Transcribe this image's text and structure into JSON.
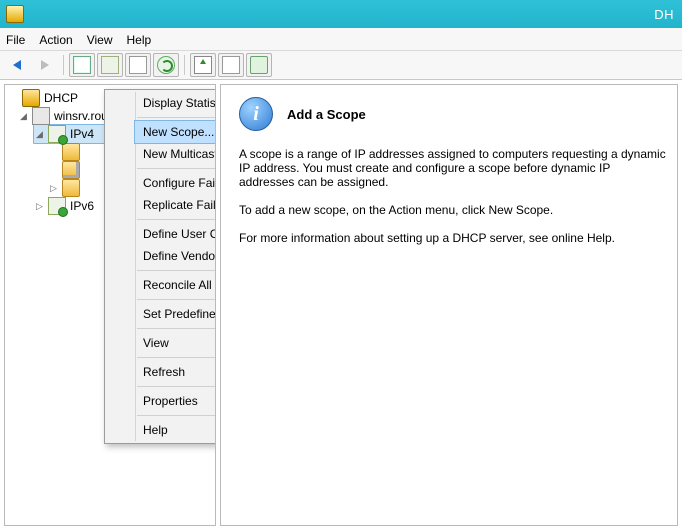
{
  "window": {
    "title_fragment": "DH"
  },
  "menubar": {
    "file": "File",
    "action": "Action",
    "view": "View",
    "help": "Help"
  },
  "tree": {
    "root": "DHCP",
    "server": "winsrv.roundrobin.com",
    "ipv4": "IPv4",
    "ipv6": "IPv6"
  },
  "content": {
    "heading": "Add a Scope",
    "p1": "A scope is a range of IP addresses assigned to computers requesting a dynamic IP address. You must create and configure a scope before dynamic IP addresses can be assigned.",
    "p2": "To add a new scope, on the Action menu, click New Scope.",
    "p3": "For more information about setting up a DHCP server, see online Help."
  },
  "context_menu": {
    "display_statistics": "Display Statistics...",
    "new_scope": "New Scope...",
    "new_multicast_scope": "New Multicast Scope...",
    "configure_failover": "Configure Failover...",
    "replicate_failover_scopes": "Replicate Failover Scopes...",
    "define_user_classes": "Define User Classes...",
    "define_vendor_classes": "Define Vendor Classes...",
    "reconcile_all_scopes": "Reconcile All Scopes...",
    "set_predefined_options": "Set Predefined Options...",
    "view": "View",
    "refresh": "Refresh",
    "properties": "Properties",
    "help": "Help"
  }
}
